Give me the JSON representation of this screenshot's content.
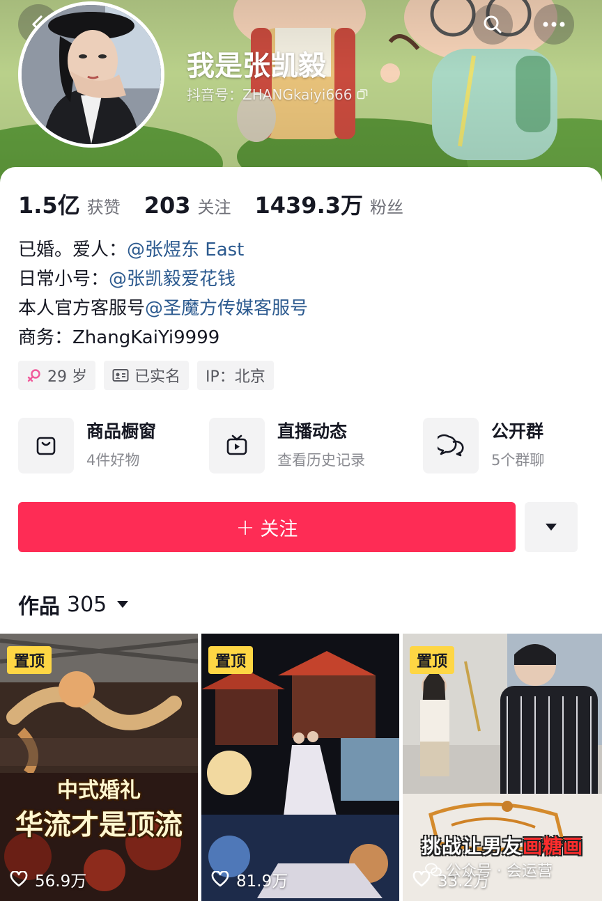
{
  "profile": {
    "nickname": "我是张凯毅",
    "douyin_id": "抖音号：ZHANGkaiyi666"
  },
  "stats": [
    {
      "value": "1.5亿",
      "label": "获赞"
    },
    {
      "value": "203",
      "label": "关注"
    },
    {
      "value": "1439.3万",
      "label": "粉丝"
    }
  ],
  "bio": {
    "line1_prefix": "已婚。爱人：",
    "line1_mention": "@张煜东 East",
    "line2_prefix": "日常小号：",
    "line2_mention": "@张凯毅爱花钱",
    "line3_prefix": "本人官方客服号",
    "line3_mention": "@圣魔方传媒客服号",
    "line4": "商务：ZhangKaiYi9999"
  },
  "tags": {
    "age": "29 岁",
    "verified": "已实名",
    "ip": "IP：北京"
  },
  "entries": [
    {
      "title": "商品橱窗",
      "sub": "4件好物",
      "icon": "shopping-bag-icon"
    },
    {
      "title": "直播动态",
      "sub": "查看历史记录",
      "icon": "tv-icon"
    },
    {
      "title": "公开群",
      "sub": "5个群聊",
      "icon": "chat-bubbles-icon"
    }
  ],
  "actions": {
    "follow_plus": "+",
    "follow_label": "关注"
  },
  "works": {
    "label": "作品",
    "count": "305"
  },
  "videos": [
    {
      "pin": "置顶",
      "caption_line1": "中式婚礼",
      "caption_line2": "华流才是顶流",
      "likes": "56.9万"
    },
    {
      "pin": "置顶",
      "likes": "81.9万"
    },
    {
      "pin": "置顶",
      "caption_a": "挑战让男友",
      "caption_b": "画糖画",
      "likes": "33.2万"
    }
  ],
  "watermark": "公众号 · 会运营",
  "colors": {
    "accent": "#fe2c55",
    "mention": "#2c5a8f",
    "pin_badge": "#fed644"
  }
}
